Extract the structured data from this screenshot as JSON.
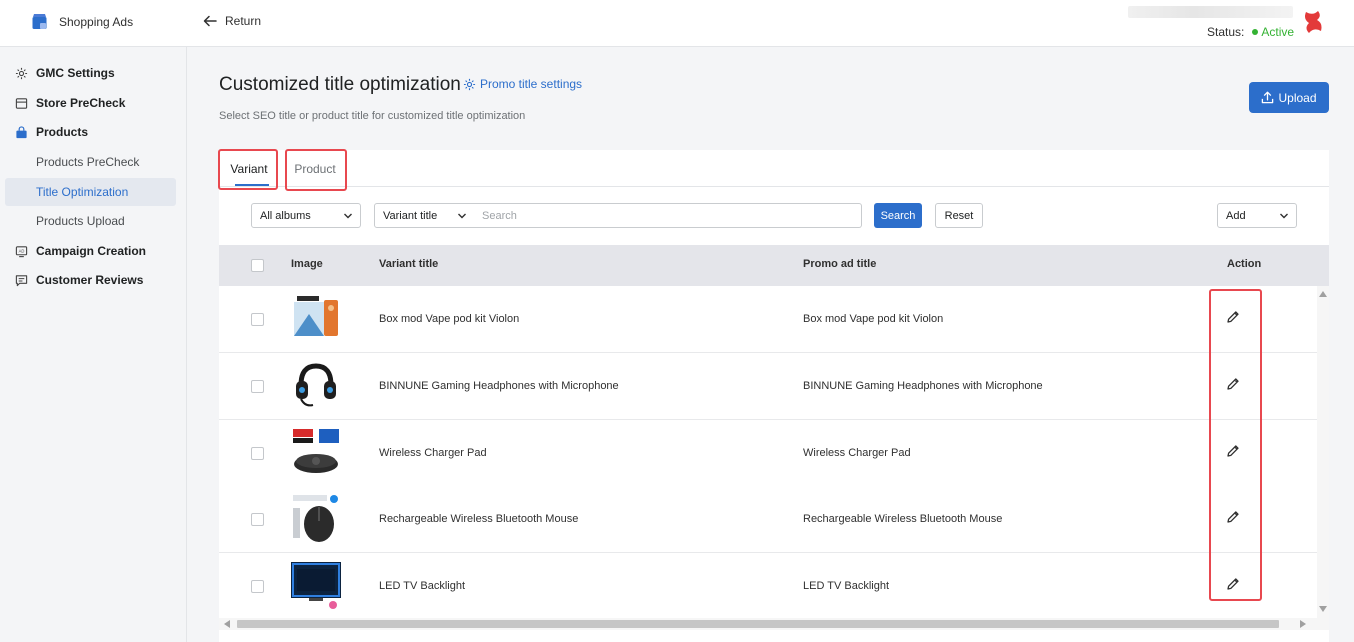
{
  "app": {
    "name": "Shopping Ads",
    "return_label": "Return",
    "status_label": "Status:",
    "status_value": "Active"
  },
  "sidebar": {
    "items": [
      {
        "label": "GMC Settings",
        "icon": "gear-icon"
      },
      {
        "label": "Store PreCheck",
        "icon": "store-icon"
      },
      {
        "label": "Products",
        "icon": "bag-icon"
      },
      {
        "label": "Campaign Creation",
        "icon": "ad-icon"
      },
      {
        "label": "Customer Reviews",
        "icon": "message-icon"
      }
    ],
    "sub_items": [
      {
        "label": "Products PreCheck"
      },
      {
        "label": "Title Optimization",
        "active": true
      },
      {
        "label": "Products Upload"
      }
    ]
  },
  "page": {
    "title": "Customized title optimization",
    "promo_link": "Promo title settings",
    "subtitle": "Select SEO title or product title for customized title optimization",
    "upload_label": "Upload"
  },
  "tabs": [
    {
      "label": "Variant",
      "active": true
    },
    {
      "label": "Product"
    }
  ],
  "filters": {
    "albums": "All albums",
    "field": "Variant title",
    "search_placeholder": "Search",
    "search_label": "Search",
    "reset_label": "Reset",
    "add_label": "Add"
  },
  "table": {
    "headers": {
      "image": "Image",
      "variant_title": "Variant title",
      "promo_title": "Promo ad title",
      "action": "Action"
    },
    "rows": [
      {
        "variant_title": "Box mod Vape pod kit Violon",
        "promo_title": "Box mod Vape pod kit Violon"
      },
      {
        "variant_title": "BINNUNE Gaming Headphones with Microphone",
        "promo_title": "BINNUNE Gaming Headphones with Microphone"
      },
      {
        "variant_title": "Wireless Charger Pad",
        "promo_title": "Wireless Charger Pad"
      },
      {
        "variant_title": "Rechargeable Wireless Bluetooth Mouse",
        "promo_title": "Rechargeable Wireless Bluetooth Mouse"
      },
      {
        "variant_title": "LED TV Backlight",
        "promo_title": "LED TV Backlight"
      }
    ]
  },
  "colors": {
    "accent": "#2c6ecb",
    "status_active": "#34b233",
    "highlight": "#e8484f"
  }
}
